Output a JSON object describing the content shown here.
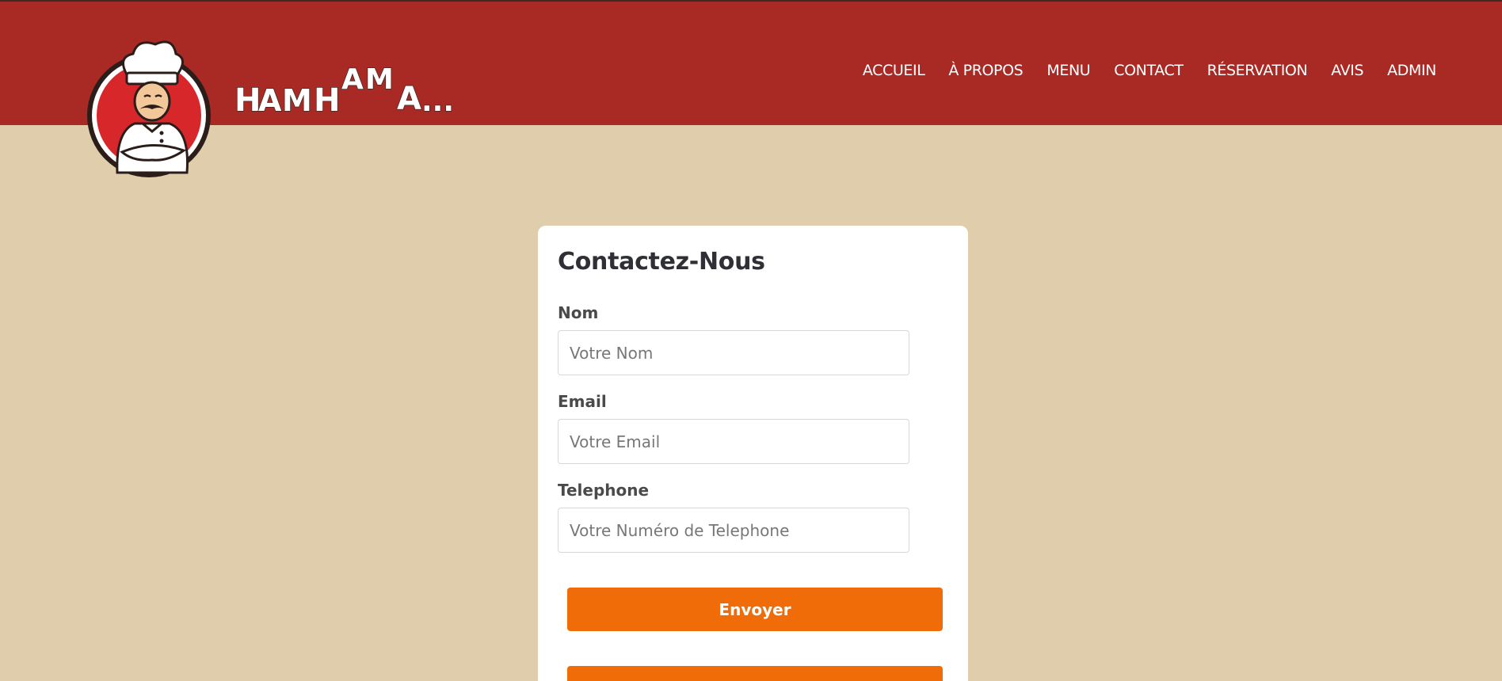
{
  "brand": {
    "logo_alt": "chef mascot logo",
    "wordmark": "HAMHAMA..."
  },
  "nav": {
    "items": [
      "ACCUEIL",
      "À PROPOS",
      "MENU",
      "CONTACT",
      "RÉSERVATION",
      "AVIS",
      "ADMIN"
    ]
  },
  "form": {
    "title": "Contactez-Nous",
    "name_label": "Nom",
    "name_placeholder": "Votre Nom",
    "email_label": "Email",
    "email_placeholder": "Votre Email",
    "phone_label": "Telephone",
    "phone_placeholder": "Votre Numéro de Telephone",
    "submit_label": "Envoyer",
    "second_button_label": ""
  },
  "colors": {
    "header": "#a92a25",
    "page_background": "#dfcdac",
    "button": "#f06c08",
    "card": "#ffffff"
  }
}
